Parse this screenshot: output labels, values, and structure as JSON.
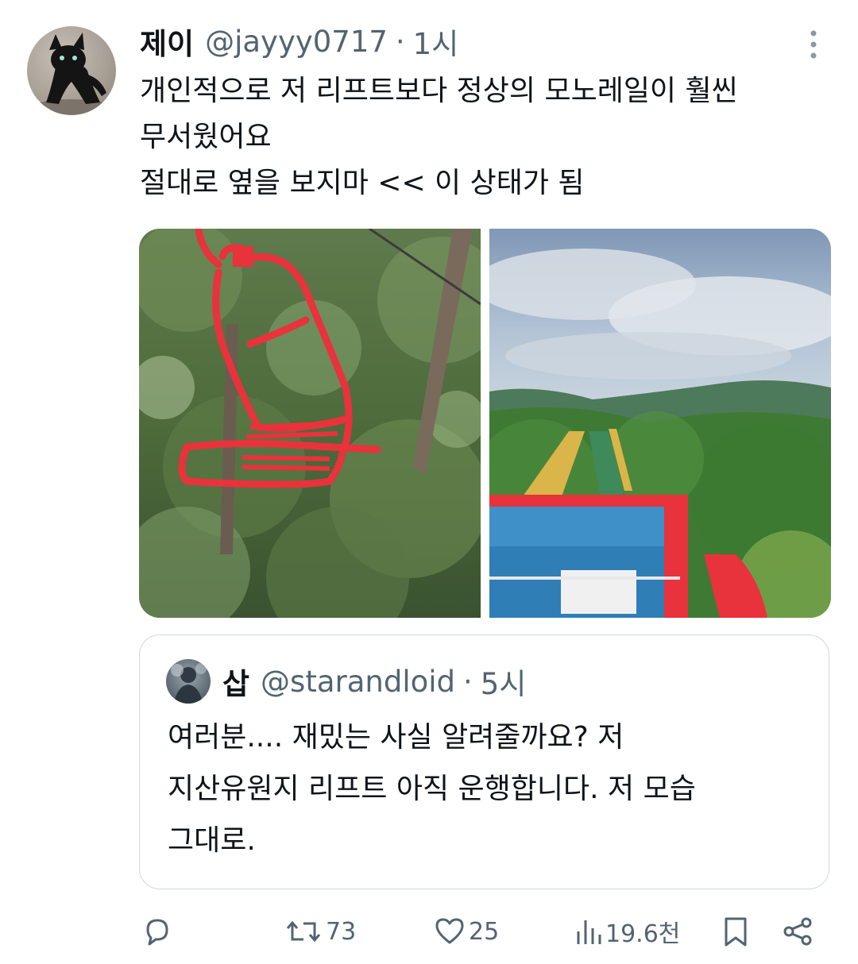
{
  "author": {
    "name": "제이",
    "handle": "@jayyy0717",
    "time": "1시"
  },
  "tweet": {
    "lines": [
      "개인적으로 저 리프트보다 정상의 모노레일이 훨씬",
      "무서웠어요",
      "절대로 옆을 보지마 << 이 상태가 됨"
    ]
  },
  "quoted": {
    "name": "삽",
    "handle": "@starandloid",
    "time": "5시",
    "lines": [
      "여러분.... 재밌는 사실 알려줄까요? 저",
      "지산유원지 리프트 아직 운행합니다. 저 모습",
      "그대로."
    ]
  },
  "metrics": {
    "replies": "",
    "retweets": "73",
    "likes": "25",
    "views": "19.6천"
  },
  "icons": {
    "more": "more-vertical-icon",
    "reply": "reply-icon",
    "retweet": "retweet-icon",
    "like": "heart-icon",
    "views": "views-icon",
    "bookmark": "bookmark-icon",
    "share": "share-icon"
  },
  "colors": {
    "text": "#0f1419",
    "secondary": "#536471",
    "border": "#cfd9de",
    "lift_red": "#e8323c"
  }
}
